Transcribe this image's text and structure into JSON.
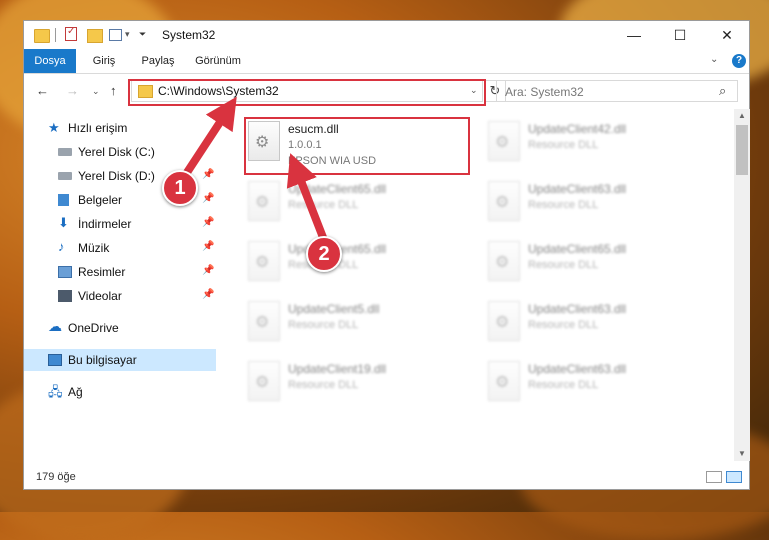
{
  "window": {
    "title": "System32",
    "minimize": "—",
    "maximize": "☐",
    "close": "✕"
  },
  "ribbon": {
    "tabs": [
      "Dosya",
      "Giriş",
      "Paylaş",
      "Görünüm"
    ],
    "expand": "⌄",
    "help": "?"
  },
  "nav": {
    "back": "←",
    "forward": "→",
    "recent": "⌄",
    "up": "↑",
    "address": "C:\\Windows\\System32",
    "address_dropdown": "⌄",
    "refresh": "↻",
    "search_placeholder": "Ara: System32",
    "search_icon": "⌕"
  },
  "sidebar": {
    "quick_access": "Hızlı erişim",
    "items": [
      {
        "label": "Yerel Disk (C:)",
        "icon": "drive-icon",
        "pinned": false
      },
      {
        "label": "Yerel Disk (D:)",
        "icon": "drive-icon",
        "pinned": true
      },
      {
        "label": "Belgeler",
        "icon": "documents-icon",
        "pinned": true
      },
      {
        "label": "İndirmeler",
        "icon": "download-icon",
        "pinned": true
      },
      {
        "label": "Müzik",
        "icon": "music-icon",
        "pinned": true
      },
      {
        "label": "Resimler",
        "icon": "pictures-icon",
        "pinned": true
      },
      {
        "label": "Videolar",
        "icon": "videos-icon",
        "pinned": true
      }
    ],
    "onedrive": "OneDrive",
    "this_pc": "Bu bilgisayar",
    "network": "Ağ",
    "pin_glyph": "📌"
  },
  "files": {
    "main": {
      "name": "esucm.dll",
      "version": "1.0.0.1",
      "description": "EPSON WIA USD"
    },
    "left_column": [
      {
        "name": "UpdateClient65.dll",
        "type": "Resource DLL"
      },
      {
        "name": "UpdateClient65.dll",
        "type": "Resource DLL"
      },
      {
        "name": "UpdateClient5.dll",
        "type": "Resource DLL"
      },
      {
        "name": "UpdateClient19.dll",
        "type": "Resource DLL"
      }
    ],
    "right_column": [
      {
        "name": "UpdateClient42.dll",
        "type": "Resource DLL"
      },
      {
        "name": "UpdateClient63.dll",
        "type": "Resource DLL"
      },
      {
        "name": "UpdateClient65.dll",
        "type": "Resource DLL"
      },
      {
        "name": "UpdateClient63.dll",
        "type": "Resource DLL"
      },
      {
        "name": "UpdateClient63.dll",
        "type": "Resource DLL"
      }
    ]
  },
  "status": {
    "item_count": "179 öğe"
  },
  "annotations": {
    "step1": "1",
    "step2": "2",
    "color": "#d9333f"
  }
}
